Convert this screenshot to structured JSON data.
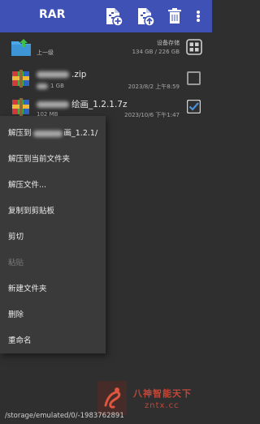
{
  "toolbar": {
    "title": "RAR",
    "icons": [
      "archive-add-icon",
      "archive-extract-icon",
      "delete-icon",
      "more-vert-icon"
    ]
  },
  "list": {
    "parent": {
      "label": "上一级",
      "storage_title": "设备存储",
      "storage_info": "134 GB / 226 GB"
    },
    "files": [
      {
        "name_suffix": ".zip",
        "size_suffix": "1 GB",
        "date": "2023/8/2 上午8:59",
        "checked": false
      },
      {
        "name_suffix": "绘画_1.2.1.7z",
        "size": "102 MB",
        "date": "2023/10/6 下午1:47",
        "checked": true
      }
    ]
  },
  "menu": {
    "items": [
      {
        "label": "解压到",
        "suffix": "画_1.2.1/",
        "enabled": true
      },
      {
        "label": "解压到当前文件夹",
        "enabled": true
      },
      {
        "label": "解压文件...",
        "enabled": true
      },
      {
        "label": "复制到剪贴板",
        "enabled": true
      },
      {
        "label": "剪切",
        "enabled": true
      },
      {
        "label": "粘贴",
        "enabled": false
      },
      {
        "label": "新建文件夹",
        "enabled": true
      },
      {
        "label": "删除",
        "enabled": true
      },
      {
        "label": "重命名",
        "enabled": true
      }
    ]
  },
  "footer": {
    "path": "/storage/emulated/0/-1983762891"
  },
  "watermark": {
    "line1": "八神智能天下",
    "line2": "zntx.cc"
  },
  "colors": {
    "toolbar": "#3f51b5",
    "background": "#2f2f2f",
    "menu": "#3a3a3a",
    "checkbox": "#4a90d9",
    "watermark": "#d44a3a"
  }
}
